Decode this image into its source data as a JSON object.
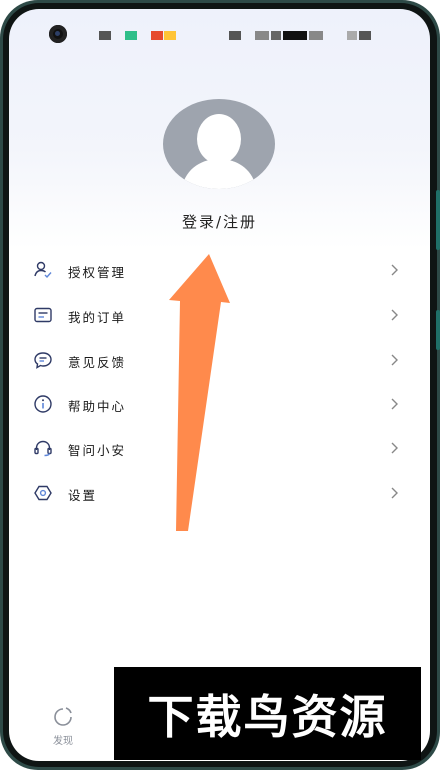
{
  "profile": {
    "login_label": "登录/注册"
  },
  "menu": [
    {
      "label": "授权管理",
      "icon": "user-check-icon"
    },
    {
      "label": "我的订单",
      "icon": "order-list-icon"
    },
    {
      "label": "意见反馈",
      "icon": "feedback-icon"
    },
    {
      "label": "帮助中心",
      "icon": "info-icon"
    },
    {
      "label": "智问小安",
      "icon": "headset-icon"
    },
    {
      "label": "设置",
      "icon": "settings-icon"
    }
  ],
  "bottom_nav": {
    "discover_label": "发现"
  },
  "watermark": {
    "text": "下载鸟资源"
  },
  "colors": {
    "arrow": "#ff8a4c",
    "text": "#1a1a1a",
    "icon": "#2f3a66"
  }
}
